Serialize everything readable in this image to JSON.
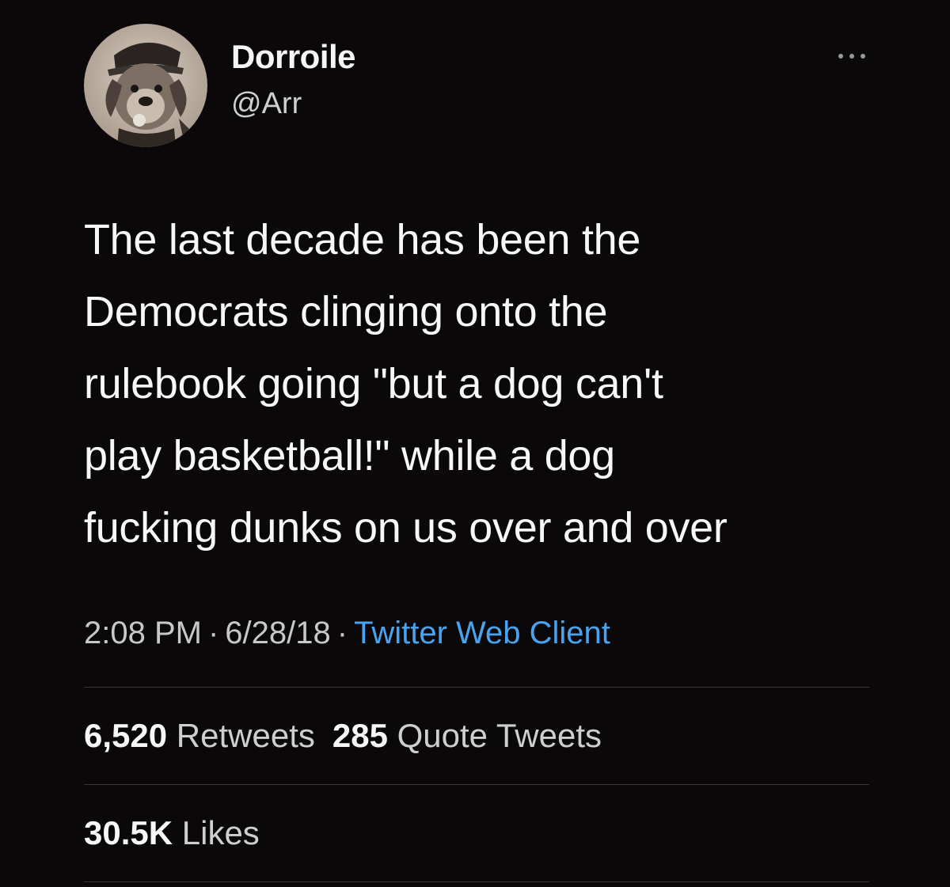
{
  "author": {
    "display_name": "Dorroile",
    "handle": "@Arr",
    "avatar_icon": "dog-in-cap-avatar"
  },
  "more_icon": "more-options-icon",
  "tweet": {
    "text": "The last decade has been the\nDemocrats clinging onto the\nrulebook going \"but a dog can't\nplay basketball!\" while a dog\nfucking dunks on us over and over"
  },
  "meta": {
    "time": "2:08 PM",
    "separator": "·",
    "date": "6/28/18",
    "client": "Twitter Web Client"
  },
  "stats": {
    "retweets_count": "6,520",
    "retweets_label": "Retweets",
    "quotes_count": "285",
    "quotes_label": "Quote Tweets",
    "likes_count": "30.5K",
    "likes_label": "Likes"
  },
  "colors": {
    "background": "#0b0809",
    "link": "#4aa3ee",
    "divider": "#3a3536"
  }
}
